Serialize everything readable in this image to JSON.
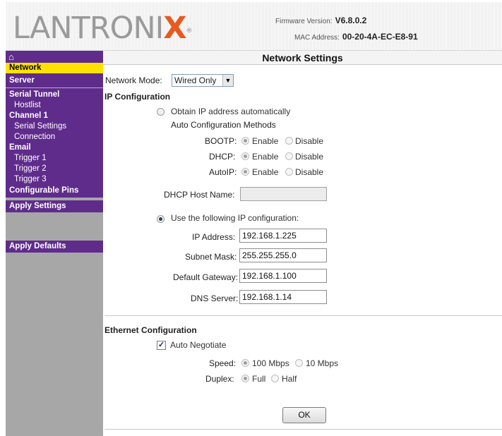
{
  "header": {
    "logo_main": "LANTRONI",
    "logo_x": "X",
    "logo_reg": "®",
    "firmware_label": "Firmware Version:",
    "firmware_value": "V6.8.0.2",
    "mac_label": "MAC Address:",
    "mac_value": "00-20-4A-EC-E8-91"
  },
  "sidebar": {
    "home_icon": "⌂",
    "items": {
      "network": "Network",
      "server": "Server",
      "serial_tunnel": "Serial Tunnel",
      "hostlist": "Hostlist",
      "channel1": "Channel 1",
      "serial_settings": "Serial Settings",
      "connection": "Connection",
      "email": "Email",
      "trigger1": "Trigger 1",
      "trigger2": "Trigger 2",
      "trigger3": "Trigger 3",
      "configurable_pins": "Configurable Pins",
      "apply_settings": "Apply Settings",
      "apply_defaults": "Apply Defaults"
    }
  },
  "page": {
    "title": "Network Settings",
    "network_mode_label": "Network Mode:",
    "network_mode_value": "Wired Only",
    "ip_config_heading": "IP Configuration",
    "obtain_auto_label": "Obtain IP address automatically",
    "auto_methods_label": "Auto Configuration Methods",
    "bootp_label": "BOOTP:",
    "dhcp_label": "DHCP:",
    "autoip_label": "AutoIP:",
    "enable_label": "Enable",
    "disable_label": "Disable",
    "dhcp_host_label": "DHCP Host Name:",
    "dhcp_host_value": "",
    "use_following_label": "Use the following IP configuration:",
    "ip_address_label": "IP Address:",
    "ip_address_value": "192.168.1.225",
    "subnet_mask_label": "Subnet Mask:",
    "subnet_mask_value": "255.255.255.0",
    "gateway_label": "Default Gateway:",
    "gateway_value": "192.168.1.100",
    "dns_label": "DNS Server:",
    "dns_value": "192.168.1.14",
    "ethernet_heading": "Ethernet Configuration",
    "auto_negotiate_label": "Auto Negotiate",
    "speed_label": "Speed:",
    "speed_100": "100 Mbps",
    "speed_10": "10 Mbps",
    "duplex_label": "Duplex:",
    "duplex_full": "Full",
    "duplex_half": "Half",
    "ok_label": "OK"
  },
  "colors": {
    "nav_purple": "#5f2c8c",
    "nav_gray": "#a7a7a7",
    "nav_selected": "#ffe100",
    "logo_x_orange": "#e85a1e"
  }
}
